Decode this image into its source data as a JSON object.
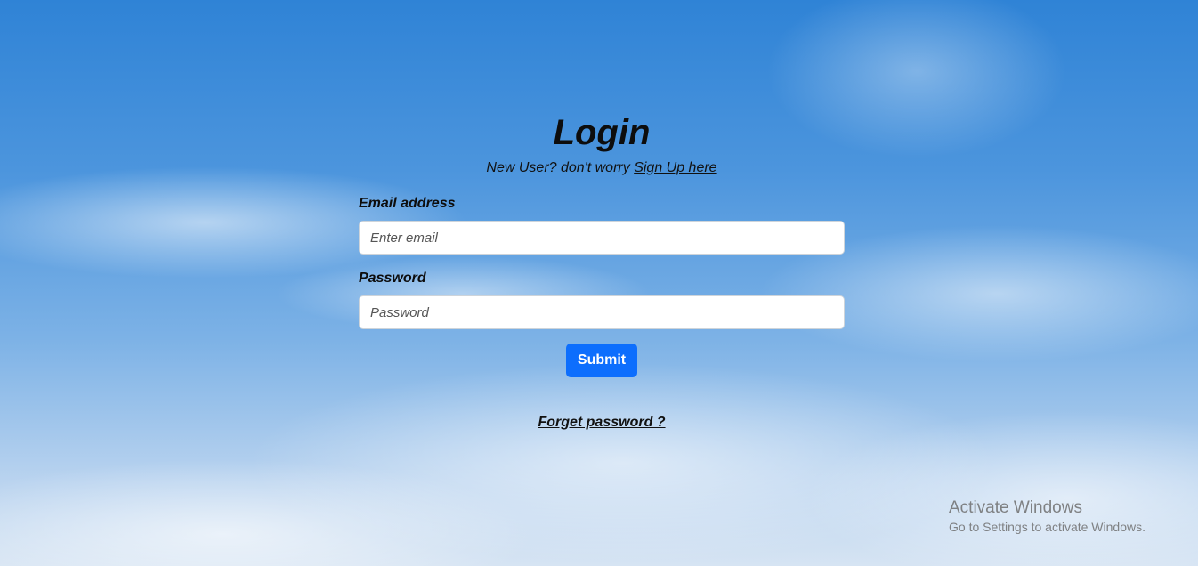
{
  "login": {
    "title": "Login",
    "signup_prompt": "New User? don't worry ",
    "signup_link": "Sign Up here",
    "email_label": "Email address",
    "email_placeholder": "Enter email",
    "email_value": "",
    "password_label": "Password",
    "password_placeholder": "Password",
    "password_value": "",
    "submit_label": "Submit",
    "forget_label": "Forget password ?"
  },
  "watermark": {
    "title": "Activate Windows",
    "subtitle": "Go to Settings to activate Windows."
  },
  "colors": {
    "primary_button": "#0d6efd",
    "sky_top": "#2f83d6",
    "sky_bottom": "#d6e4f3"
  }
}
